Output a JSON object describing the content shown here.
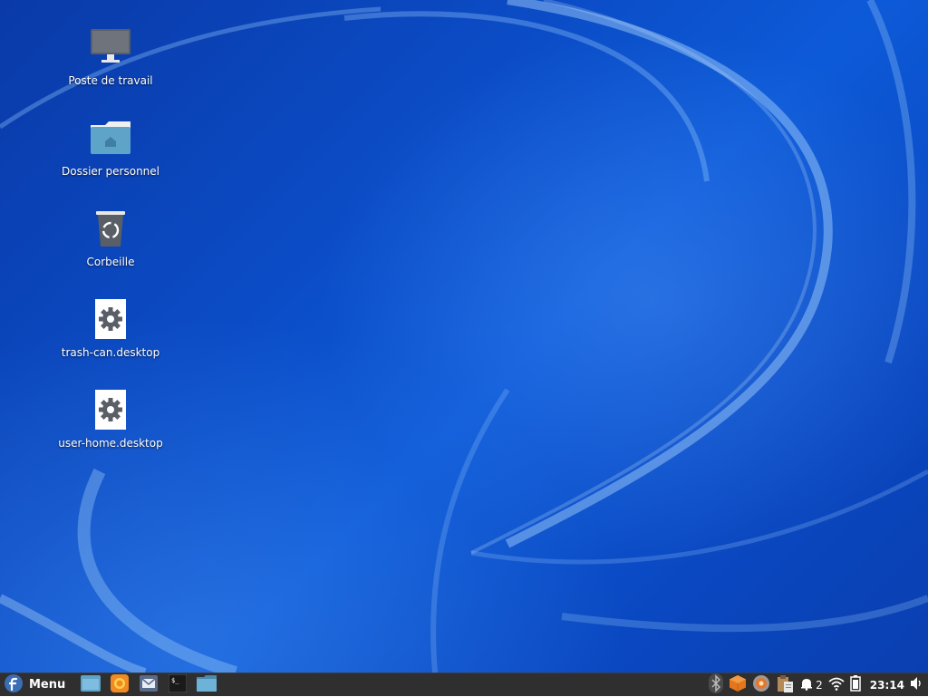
{
  "desktop": {
    "icons": [
      {
        "label": "Poste de travail",
        "icon": "computer-icon"
      },
      {
        "label": "Dossier personnel",
        "icon": "home-folder-icon"
      },
      {
        "label": "Corbeille",
        "icon": "trash-icon"
      },
      {
        "label": "trash-can.desktop",
        "icon": "desktop-file-icon"
      },
      {
        "label": "user-home.desktop",
        "icon": "desktop-file-icon"
      }
    ]
  },
  "taskbar": {
    "menu_label": "Menu",
    "menu_icon": "fedora-logo-icon",
    "launchers": [
      {
        "icon": "show-desktop-icon"
      },
      {
        "icon": "firefox-icon"
      },
      {
        "icon": "mail-icon"
      },
      {
        "icon": "terminal-icon"
      },
      {
        "icon": "file-manager-icon"
      }
    ],
    "tray": {
      "items": [
        "bluetooth-icon",
        "package-updater-icon",
        "screenshot-tool-icon",
        "clipboard-icon",
        "notification-bell-icon",
        "wifi-icon",
        "battery-icon",
        "volume-icon"
      ],
      "notification_count": "2",
      "clock": "23:14"
    }
  },
  "colors": {
    "wallpaper_base": "#0b4cc6",
    "taskbar_bg": "#2f2f2f",
    "text_light": "#ffffff"
  }
}
